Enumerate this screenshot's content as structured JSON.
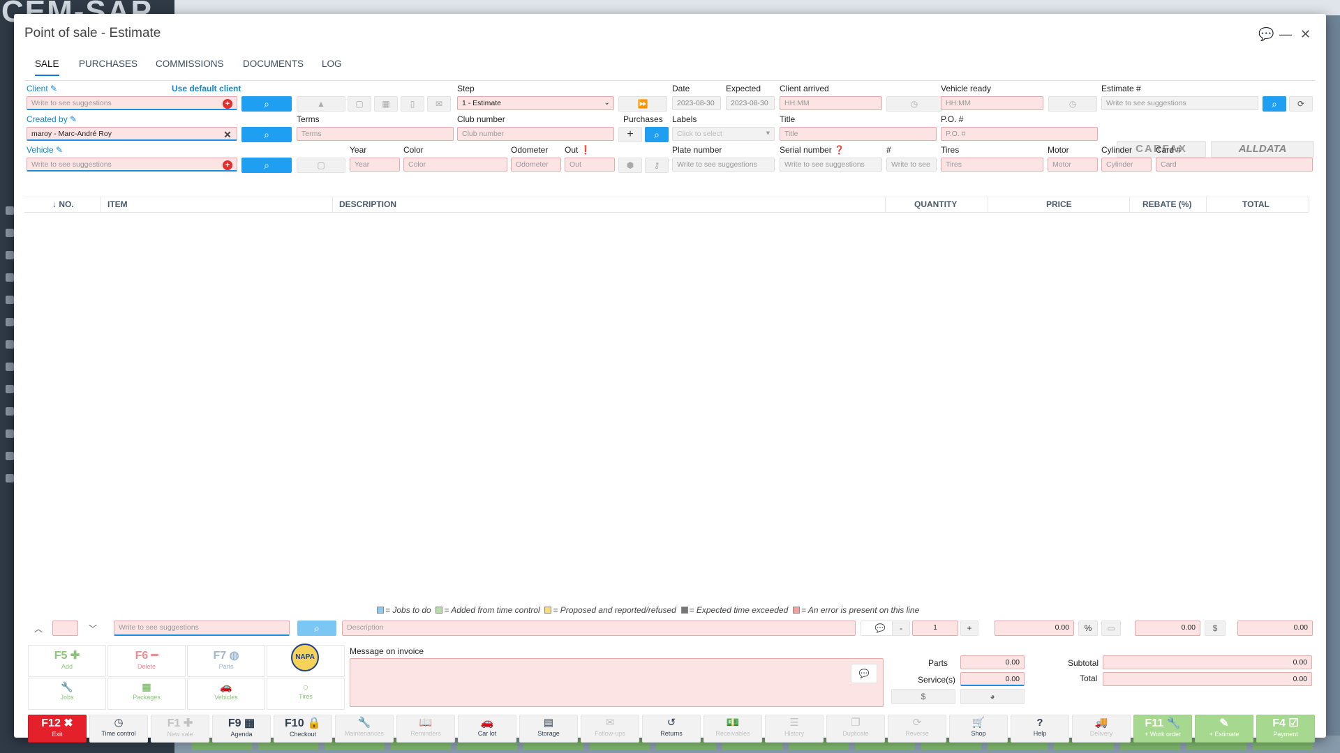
{
  "background": {
    "logo": "CEM-SAP"
  },
  "window": {
    "title": "Point of sale - Estimate"
  },
  "tabs": [
    "SALE",
    "PURCHASES",
    "COMMISSIONS",
    "DOCUMENTS",
    "LOG"
  ],
  "client": {
    "label": "Client",
    "use_default": "Use default client",
    "placeholder": "Write to see suggestions"
  },
  "created_by": {
    "label": "Created by",
    "value": "maroy - Marc-André Roy"
  },
  "vehicle": {
    "label": "Vehicle",
    "placeholder": "Write to see suggestions"
  },
  "step": {
    "label": "Step",
    "value": "1 - Estimate"
  },
  "date": {
    "label": "Date",
    "value": "2023-08-30"
  },
  "expected": {
    "label": "Expected",
    "value": "2023-08-30"
  },
  "client_arrived": {
    "label": "Client arrived",
    "placeholder": "HH:MM"
  },
  "vehicle_ready": {
    "label": "Vehicle ready",
    "placeholder": "HH:MM"
  },
  "estimate_no": {
    "label": "Estimate #",
    "placeholder": "Write to see suggestions"
  },
  "terms": {
    "label": "Terms",
    "placeholder": "Terms"
  },
  "club_number": {
    "label": "Club number",
    "placeholder": "Club number"
  },
  "purchases": {
    "label": "Purchases"
  },
  "labels": {
    "label": "Labels",
    "placeholder": "Click to select"
  },
  "title_field": {
    "label": "Title",
    "placeholder": "Title"
  },
  "po": {
    "label": "P.O. #",
    "placeholder": "P.O. #"
  },
  "year": {
    "label": "Year",
    "placeholder": "Year"
  },
  "color": {
    "label": "Color",
    "placeholder": "Color"
  },
  "odometer": {
    "label": "Odometer",
    "placeholder": "Odometer"
  },
  "out": {
    "label": "Out",
    "placeholder": "Out"
  },
  "plate": {
    "label": "Plate number",
    "placeholder": "Write to see suggestions"
  },
  "serial": {
    "label": "Serial number",
    "placeholder": "Write to see suggestions"
  },
  "hash": {
    "label": "#",
    "placeholder": "Write to see"
  },
  "tires": {
    "label": "Tires",
    "placeholder": "Tires"
  },
  "motor": {
    "label": "Motor",
    "placeholder": "Motor"
  },
  "cylinder": {
    "label": "Cylinder",
    "placeholder": "Cylinder"
  },
  "card": {
    "label": "Card #",
    "placeholder": "Card"
  },
  "brands": {
    "carfax": "CARFAX",
    "alldata": "ALLDATA",
    "napa": "NAPA"
  },
  "table": {
    "headers": [
      "↓ NO.",
      "ITEM",
      "DESCRIPTION",
      "QUANTITY",
      "PRICE",
      "REBATE (%)",
      "TOTAL"
    ]
  },
  "legend": [
    {
      "text": "= Jobs to do",
      "color": "#8ecaf0"
    },
    {
      "text": "= Added from time control",
      "color": "#b7dca6"
    },
    {
      "text": "= Proposed and reported/refused",
      "color": "#f6dc7a"
    },
    {
      "text": "= Expected time exceeded",
      "color": "#777777"
    },
    {
      "text": "= An error is present on this line",
      "color": "#f3a0a0"
    }
  ],
  "line_entry": {
    "search_placeholder": "Write to see suggestions",
    "desc_placeholder": "Description",
    "qty": "1",
    "price": "0.00",
    "rebate": "0.00",
    "total": "0.00",
    "minus": "-",
    "plus": "+"
  },
  "fkeys": [
    {
      "key": "F5 ✚",
      "sub": "Add",
      "color": "#8bc47a"
    },
    {
      "key": "F6 ━",
      "sub": "Delete",
      "color": "#e88f8f"
    },
    {
      "key": "F7 ◍",
      "sub": "Parts",
      "color": "#9fb8d2"
    }
  ],
  "quick": [
    "Jobs",
    "Packages",
    "Vehicles",
    "Tires"
  ],
  "message": {
    "label": "Message on invoice"
  },
  "totals": {
    "parts_label": "Parts",
    "parts": "0.00",
    "services_label": "Service(s)",
    "services": "0.00",
    "subtotal_label": "Subtotal",
    "subtotal": "0.00",
    "total_label": "Total",
    "total": "0.00"
  },
  "bottom": [
    {
      "key": "F12 ✖",
      "sub": "Exit",
      "style": "red"
    },
    {
      "icon": "◷",
      "sub": "Time control",
      "style": "dark"
    },
    {
      "key": "F1 ✚",
      "sub": "New sale",
      "style": ""
    },
    {
      "key": "F9 ▦",
      "sub": "Agenda",
      "style": "dark"
    },
    {
      "key": "F10 🔒",
      "sub": "Checkout",
      "style": "dark"
    },
    {
      "icon": "🔧",
      "sub": "Maintenances",
      "style": ""
    },
    {
      "icon": "📖",
      "sub": "Reminders",
      "style": ""
    },
    {
      "icon": "🚗",
      "sub": "Car lot",
      "style": "dark"
    },
    {
      "icon": "▤",
      "sub": "Storage",
      "style": "dark"
    },
    {
      "icon": "✉",
      "sub": "Follow-ups",
      "style": ""
    },
    {
      "icon": "↺",
      "sub": "Returns",
      "style": "dark"
    },
    {
      "icon": "💵",
      "sub": "Receivables",
      "style": ""
    },
    {
      "icon": "☰",
      "sub": "History",
      "style": ""
    },
    {
      "icon": "❐",
      "sub": "Duplicate",
      "style": ""
    },
    {
      "icon": "⟳",
      "sub": "Reverse",
      "style": ""
    },
    {
      "icon": "🛒",
      "sub": "Shop",
      "style": "dark"
    },
    {
      "icon": "?",
      "sub": "Help",
      "style": "dark"
    },
    {
      "icon": "🚚",
      "sub": "Delivery",
      "style": ""
    },
    {
      "key": "F11 🔧",
      "sub": "+ Work order",
      "style": "green"
    },
    {
      "key": "✎",
      "sub": "+ Estimate",
      "style": "green"
    },
    {
      "key": "F4 ☑",
      "sub": "Payment",
      "style": "green"
    }
  ]
}
